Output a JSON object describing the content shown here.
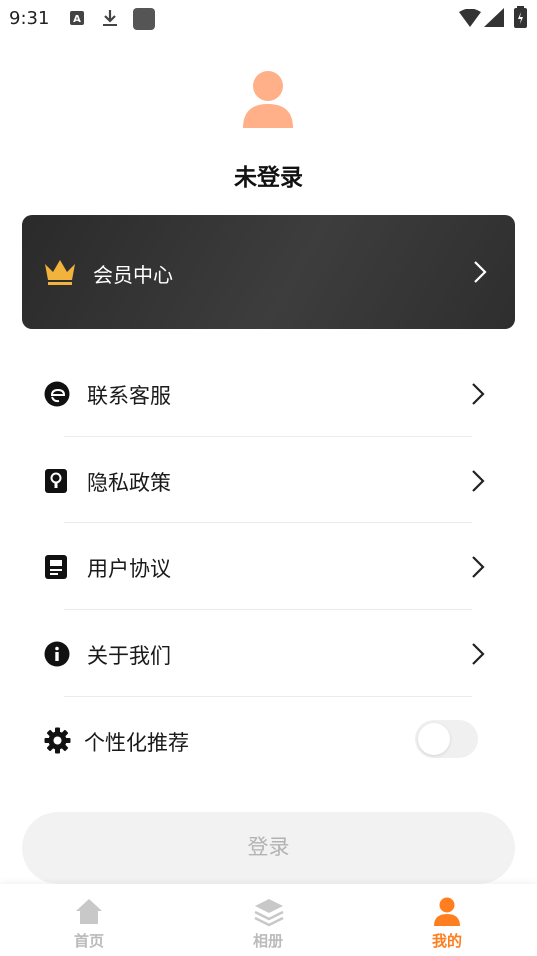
{
  "status_bar": {
    "time": "9:31"
  },
  "profile": {
    "avatar_icon": "user-avatar-icon",
    "login_status": "未登录"
  },
  "vip": {
    "label": "会员中心",
    "icon": "crown-icon"
  },
  "menu": {
    "items": [
      {
        "label": "联系客服",
        "icon": "customer-service-icon"
      },
      {
        "label": "隐私政策",
        "icon": "privacy-icon"
      },
      {
        "label": "用户协议",
        "icon": "user-agreement-icon"
      },
      {
        "label": "关于我们",
        "icon": "info-icon"
      }
    ],
    "toggle_item": {
      "label": "个性化推荐",
      "icon": "gear-icon",
      "enabled": false
    }
  },
  "login_button": {
    "label": "登录"
  },
  "bottom_nav": {
    "tabs": [
      {
        "label": "首页",
        "icon": "home-icon",
        "active": false
      },
      {
        "label": "相册",
        "icon": "layers-icon",
        "active": false
      },
      {
        "label": "我的",
        "icon": "profile-icon",
        "active": true
      }
    ]
  },
  "colors": {
    "accent": "#ff7e1f",
    "avatar": "#ffb088",
    "crown": "#f2b33d",
    "vip_card": "#333333"
  }
}
